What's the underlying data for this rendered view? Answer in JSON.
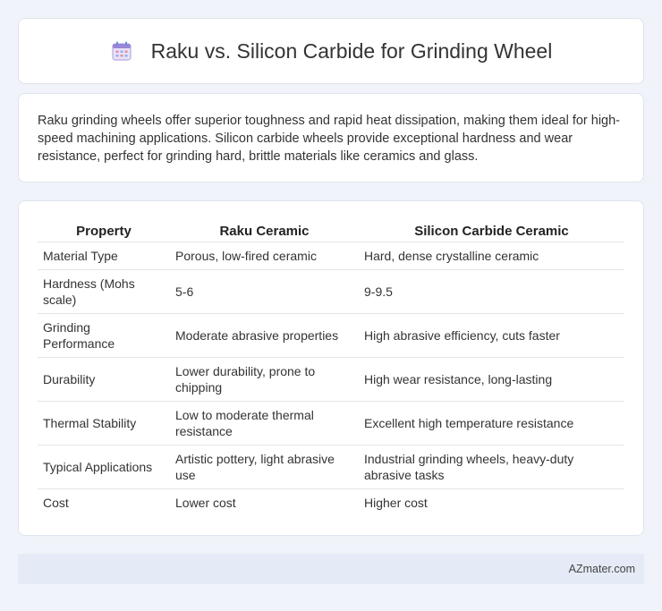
{
  "header": {
    "title": "Raku vs. Silicon Carbide for Grinding Wheel",
    "icon": "calendar-icon"
  },
  "intro": {
    "text": "Raku grinding wheels offer superior toughness and rapid heat dissipation, making them ideal for high-speed machining applications. Silicon carbide wheels provide exceptional hardness and wear resistance, perfect for grinding hard, brittle materials like ceramics and glass."
  },
  "table": {
    "headers": [
      "Property",
      "Raku Ceramic",
      "Silicon Carbide Ceramic"
    ],
    "rows": [
      [
        "Material Type",
        "Porous, low-fired ceramic",
        "Hard, dense crystalline ceramic"
      ],
      [
        "Hardness (Mohs scale)",
        "5-6",
        "9-9.5"
      ],
      [
        "Grinding Performance",
        "Moderate abrasive properties",
        "High abrasive efficiency, cuts faster"
      ],
      [
        "Durability",
        "Lower durability, prone to chipping",
        "High wear resistance, long-lasting"
      ],
      [
        "Thermal Stability",
        "Low to moderate thermal resistance",
        "Excellent high temperature resistance"
      ],
      [
        "Typical Applications",
        "Artistic pottery, light abrasive use",
        "Industrial grinding wheels, heavy-duty abrasive tasks"
      ],
      [
        "Cost",
        "Lower cost",
        "Higher cost"
      ]
    ]
  },
  "footer": {
    "brand": "AZmater.com"
  }
}
